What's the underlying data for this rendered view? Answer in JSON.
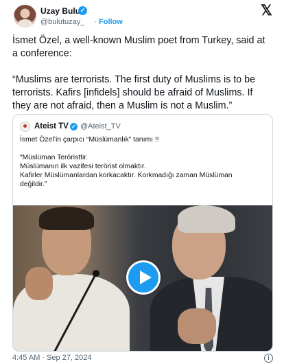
{
  "author": {
    "name": "Uzay Bulut",
    "handle": "@bulutuzay_",
    "separator": "·",
    "follow_label": "Follow",
    "verified_icon": "verified-badge-icon",
    "avatar_icon": "avatar"
  },
  "platform_icon": "x-logo-icon",
  "tweet": {
    "paragraph_1": "İsmet Özel, a well-known Muslim poet from Turkey, said at\na conference:",
    "paragraph_2": "“Muslims are terrorists. The first duty of Muslims is to be\nterrorists. Kafirs [infidels] should be afraid of Muslims. If\nthey are not afraid, then a Muslim is not a Muslim.”"
  },
  "quoted_tweet": {
    "name": "Ateist TV",
    "handle": "@Ateist_TV",
    "line_1": "İsmet Özel’in çarpıcı “Müslümanlık” tanımı !!",
    "quote_text": "“Müslüman Teröristtir.\nMüslümanın ilk vazifesi terörist olmaktır.\nKafirler Müslümanlardan korkacaktır. Korkmadığı zaman Müslüman\ndeğildir.”",
    "media": {
      "type": "video",
      "play_icon": "play-icon"
    }
  },
  "footer": {
    "time": "4:45 AM",
    "separator": "·",
    "date": "Sep 27, 2024",
    "info_icon": "info-icon"
  },
  "colors": {
    "accent": "#1d9bf0",
    "text": "#0f1419",
    "muted": "#536471",
    "border": "#cfd9de"
  }
}
